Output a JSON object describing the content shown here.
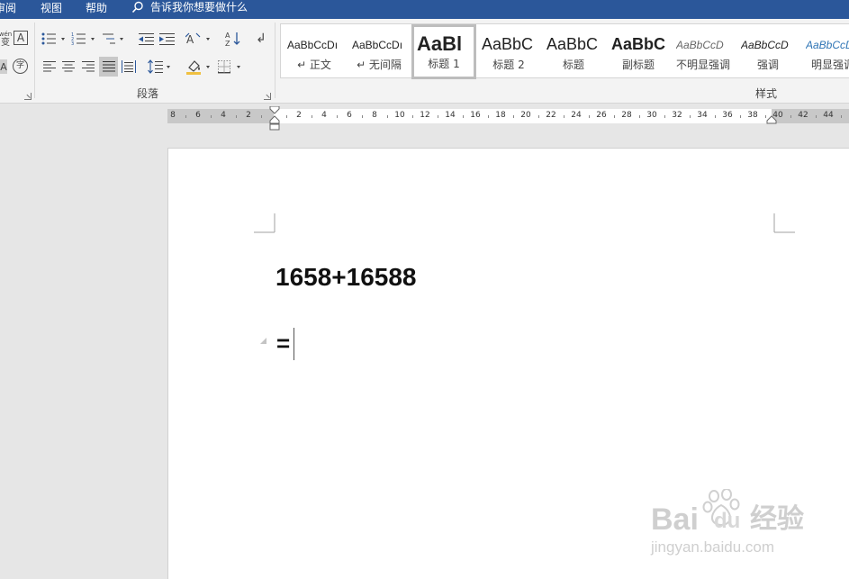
{
  "tabs": {
    "items": [
      "审阅",
      "视图",
      "帮助"
    ],
    "search_text": "告诉我你想要做什么"
  },
  "ribbon": {
    "font_partial": {
      "phonetic_label": "wén",
      "phonetic_char": "变",
      "enclose_char": "字"
    },
    "paragraph_group_label": "段落",
    "styles_group_label": "样式",
    "styles": [
      {
        "preview": "AaBbCcDı",
        "name": "↵ 正文"
      },
      {
        "preview": "AaBbCcDı",
        "name": "↵ 无间隔"
      },
      {
        "preview": "AaBl",
        "name": "标题 1"
      },
      {
        "preview": "AaBbC",
        "name": "标题 2"
      },
      {
        "preview": "AaBbC",
        "name": "标题"
      },
      {
        "preview": "AaBbC",
        "name": "副标题"
      },
      {
        "preview": "AaBbCcD",
        "name": "不明显强调"
      },
      {
        "preview": "AaBbCcD",
        "name": "强调"
      },
      {
        "preview": "AaBbCcD",
        "name": "明显强调"
      }
    ],
    "selected_style": "标题 1"
  },
  "ruler": {
    "left_labels": [
      "8",
      "6",
      "4",
      "2"
    ],
    "right_labels": [
      "2",
      "4",
      "6",
      "8",
      "10",
      "12",
      "14",
      "16",
      "18",
      "20",
      "22",
      "24",
      "26",
      "28",
      "30",
      "32",
      "34",
      "36",
      "38",
      "40",
      "42",
      "44"
    ]
  },
  "document": {
    "line1": "1658+16588",
    "line2": "="
  },
  "watermark": {
    "brand": "Bai",
    "brand2": "经验",
    "url": "jingyan.baidu.com"
  },
  "colors": {
    "titlebar": "#2b579a",
    "ribbon": "#f3f3f3",
    "workspace": "#e6e6e6",
    "heading_accent": "#2e74b5"
  }
}
